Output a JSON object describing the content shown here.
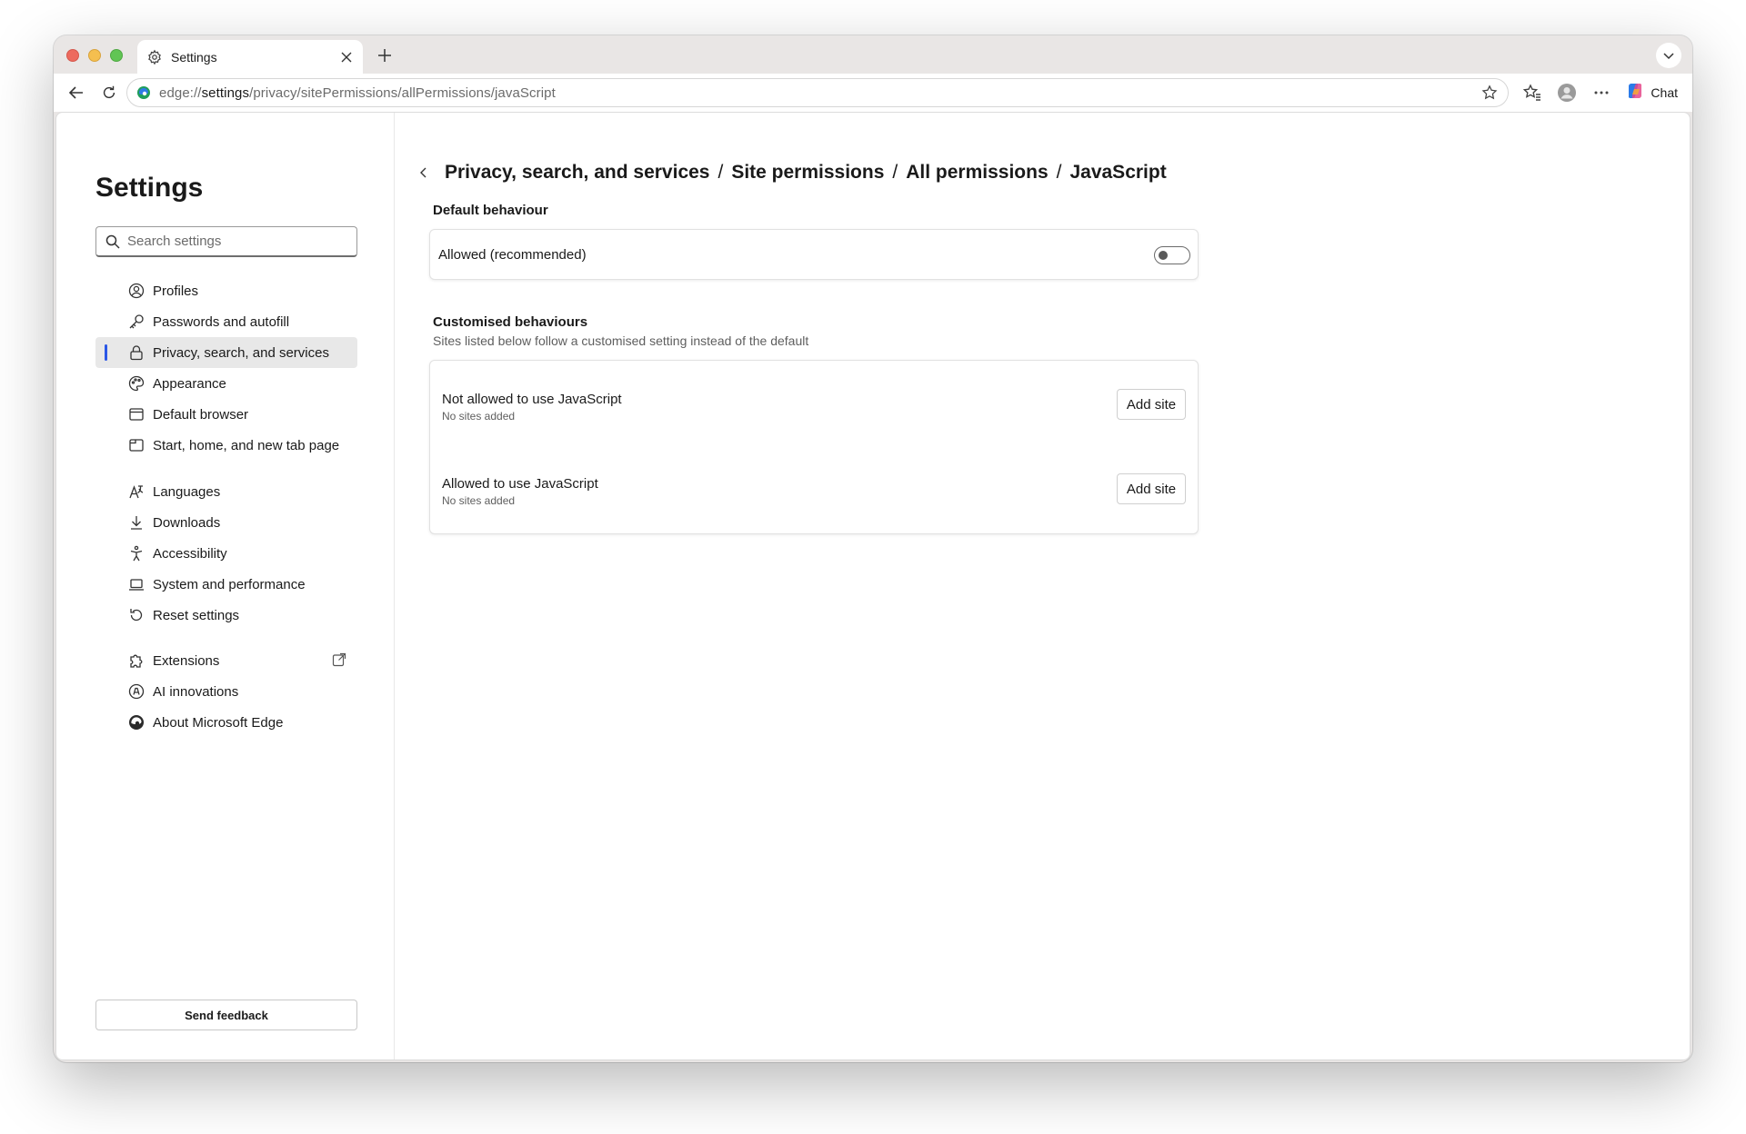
{
  "browser": {
    "tab_title": "Settings",
    "url_scheme": "edge://",
    "url_host": "settings",
    "url_path": "/privacy/sitePermissions/allPermissions/javaScript",
    "chat_label": "Chat"
  },
  "sidebar": {
    "title": "Settings",
    "search_placeholder": "Search settings",
    "items": [
      {
        "label": "Profiles",
        "icon": "profiles-icon"
      },
      {
        "label": "Passwords and autofill",
        "icon": "key-icon"
      },
      {
        "label": "Privacy, search, and services",
        "icon": "lock-icon"
      },
      {
        "label": "Appearance",
        "icon": "palette-icon"
      },
      {
        "label": "Default browser",
        "icon": "browser-window-icon"
      },
      {
        "label": "Start, home, and new tab page",
        "icon": "home-tab-icon"
      },
      {
        "label": "Languages",
        "icon": "languages-icon"
      },
      {
        "label": "Downloads",
        "icon": "download-icon"
      },
      {
        "label": "Accessibility",
        "icon": "accessibility-icon"
      },
      {
        "label": "System and performance",
        "icon": "laptop-icon"
      },
      {
        "label": "Reset settings",
        "icon": "reset-icon"
      },
      {
        "label": "Extensions",
        "icon": "puzzle-icon"
      },
      {
        "label": "AI innovations",
        "icon": "ai-icon"
      },
      {
        "label": "About Microsoft Edge",
        "icon": "edge-logo-icon"
      }
    ],
    "feedback_label": "Send feedback"
  },
  "main": {
    "breadcrumb": [
      "Privacy, search, and services",
      "Site permissions",
      "All permissions",
      "JavaScript"
    ],
    "breadcrumb_sep": "/",
    "default_section": {
      "title": "Default behaviour",
      "toggle_label": "Allowed (recommended)",
      "toggle_on": false
    },
    "custom_section": {
      "title": "Customised behaviours",
      "subtitle": "Sites listed below follow a customised setting instead of the default",
      "rows": [
        {
          "title": "Not allowed to use JavaScript",
          "status": "No sites added",
          "button": "Add site"
        },
        {
          "title": "Allowed to use JavaScript",
          "status": "No sites added",
          "button": "Add site"
        }
      ]
    }
  },
  "colors": {
    "accent": "#2b57e6",
    "active_nav_bg": "#e8e8e8",
    "frame_bg": "#e9e6e5"
  }
}
